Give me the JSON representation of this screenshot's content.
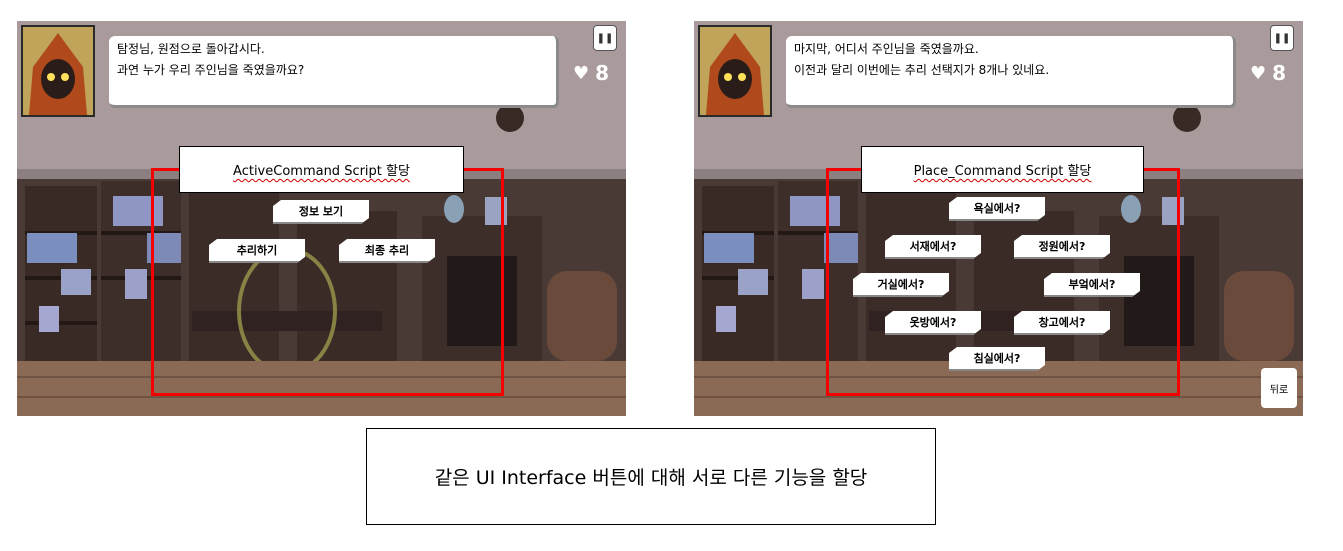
{
  "colors": {
    "highlight_red": "#f50000",
    "floor": "#8a6a55",
    "wall": "#a99b9b"
  },
  "left_panel": {
    "dialog_line1": "탐정님, 원점으로 돌아갑시다.",
    "dialog_line2": "과연 누가 우리 주인님을 죽였을까요?",
    "pause_icon": "pause-icon",
    "lives": "8",
    "annotation_label": "ActiveCommand Script 할당",
    "buttons": {
      "info": "정보 보기",
      "deduce": "추리하기",
      "final": "최종 추리"
    }
  },
  "right_panel": {
    "dialog_line1": "마지막, 어디서 주인님을 죽였을까요.",
    "dialog_line2": "이전과 달리 이번에는 추리 선택지가 8개나 있네요.",
    "pause_icon": "pause-icon",
    "lives": "8",
    "annotation_label": "Place_Command Script 할당",
    "buttons": {
      "bathroom": "욕실에서?",
      "study": "서재에서?",
      "garden": "정원에서?",
      "living": "거실에서?",
      "kitchen": "부엌에서?",
      "dressing": "옷방에서?",
      "storage": "창고에서?",
      "bedroom": "침실에서?"
    },
    "back": "뒤로"
  },
  "caption": "같은 UI Interface 버튼에 대해 서로 다른 기능을 할당"
}
